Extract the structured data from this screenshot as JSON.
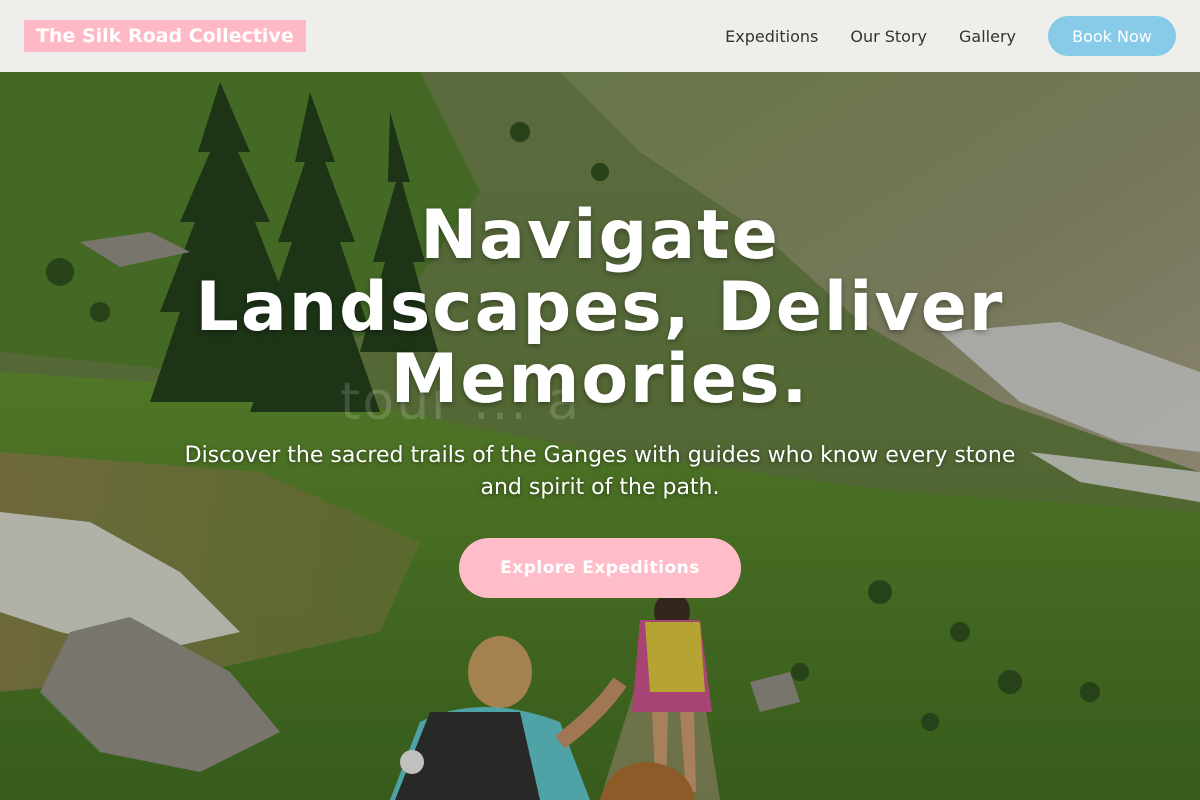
{
  "header": {
    "brand": "The Silk Road Collective",
    "nav": [
      {
        "label": "Expeditions"
      },
      {
        "label": "Our Story"
      },
      {
        "label": "Gallery"
      }
    ],
    "cta_label": "Book Now"
  },
  "hero": {
    "headline_line1": "Navigate",
    "headline_line2": "Landscapes, Deliver",
    "headline_line3": "Memories.",
    "subtext": "Discover the sacred trails of the Ganges with guides who know every stone and spirit of the path.",
    "cta_label": "Explore Expeditions",
    "watermark": "tour ... a",
    "background_image": "mountain-hikers-photo"
  },
  "colors": {
    "brand_bg": "#ffb9c6",
    "book_button": "#87cbe9",
    "cta_button": "#ffbcc9",
    "header_bg": "#f6f6f4",
    "nav_text": "#333333"
  }
}
